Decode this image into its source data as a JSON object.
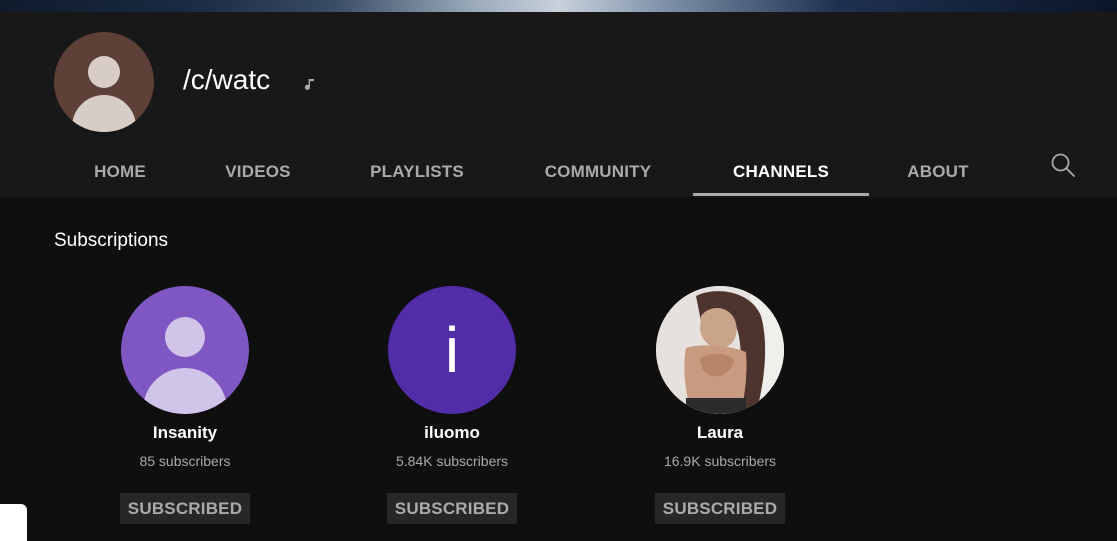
{
  "channel": {
    "title": "/c/watc",
    "avatar_color": "#5d4037"
  },
  "tabs": [
    {
      "label": "HOME",
      "active": false
    },
    {
      "label": "VIDEOS",
      "active": false
    },
    {
      "label": "PLAYLISTS",
      "active": false
    },
    {
      "label": "COMMUNITY",
      "active": false
    },
    {
      "label": "CHANNELS",
      "active": true
    },
    {
      "label": "ABOUT",
      "active": false
    }
  ],
  "section": {
    "title": "Subscriptions"
  },
  "subscriptions": [
    {
      "name": "Insanity",
      "subscribers": "85 subscribers",
      "button": "SUBSCRIBED",
      "avatar": "default-person",
      "avatar_color": "#7e57c2"
    },
    {
      "name": "iluomo",
      "subscribers": "5.84K subscribers",
      "button": "SUBSCRIBED",
      "avatar_letter": "i",
      "avatar_color": "#512da8"
    },
    {
      "name": "Laura",
      "subscribers": "16.9K subscribers",
      "button": "SUBSCRIBED",
      "avatar": "photo"
    }
  ],
  "icons": {
    "music": "music-note-icon",
    "search": "search-icon"
  },
  "colors": {
    "background": "#0f0f0f",
    "header": "#181818",
    "tab_inactive": "#aaaaaa",
    "tab_active": "#ffffff",
    "button_bg": "#272727"
  }
}
